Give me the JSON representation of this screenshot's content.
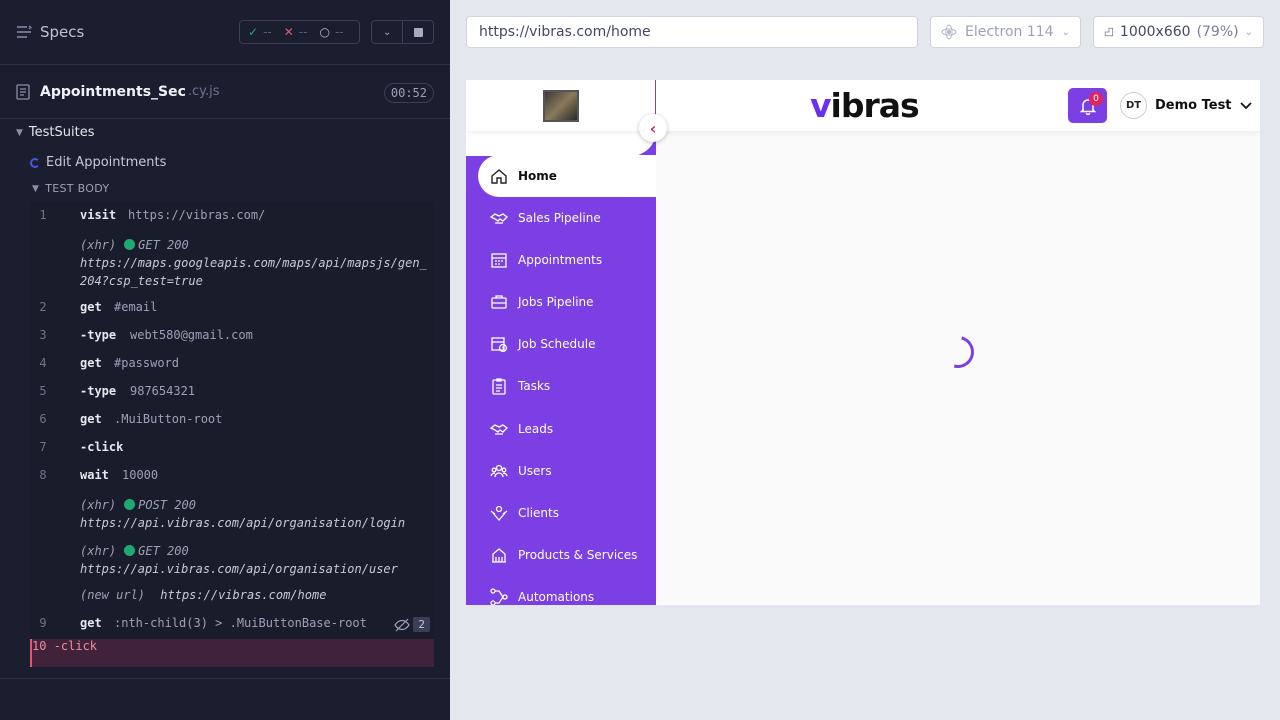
{
  "reporter": {
    "specs_label": "Specs",
    "stats": {
      "passed": "--",
      "failed": "--",
      "pending": "--"
    },
    "file": {
      "name": "Appointments_Sec",
      "ext": ".cy.js",
      "duration": "00:52"
    },
    "suite": "TestSuites",
    "test": "Edit Appointments",
    "body_label": "TEST BODY",
    "commands": [
      {
        "num": "1",
        "name": "visit",
        "message": "https://vibras.com/"
      },
      {
        "num": "2",
        "name": "get",
        "message": "#email"
      },
      {
        "num": "3",
        "name": "-type",
        "message": "webt580@gmail.com"
      },
      {
        "num": "4",
        "name": "get",
        "message": "#password"
      },
      {
        "num": "5",
        "name": "-type",
        "message": "987654321"
      },
      {
        "num": "6",
        "name": "get",
        "message": ".MuiButton-root"
      },
      {
        "num": "7",
        "name": "-click",
        "message": ""
      },
      {
        "num": "8",
        "name": "wait",
        "message": "10000"
      },
      {
        "num": "9",
        "name": "get",
        "message": ":nth-child(3) > .MuiButtonBase-root",
        "hidden_count": "2"
      },
      {
        "num": "10",
        "name": "-click",
        "message": ""
      }
    ],
    "logs": [
      {
        "tag": "(xhr)",
        "status": "GET 200",
        "url": "https://maps.googleapis.com/maps/api/mapsjs/gen_204?csp_test=true"
      },
      {
        "tag": "(xhr)",
        "status": "POST 200",
        "url": "https://api.vibras.com/api/organisation/login"
      },
      {
        "tag": "(xhr)",
        "status": "GET 200",
        "url": "https://api.vibras.com/api/organisation/user"
      },
      {
        "tag": "(new url)",
        "url": "https://vibras.com/home"
      }
    ]
  },
  "aut": {
    "url": "https://vibras.com/home",
    "browser": "Electron 114",
    "viewport": "1000x660",
    "scale": "(79%)"
  },
  "app": {
    "brand_v": "v",
    "brand_rest": "ibras",
    "notifications": "0",
    "user_initials": "DT",
    "user_name": "Demo Test",
    "nav": [
      {
        "label": "Home",
        "icon": "home-icon"
      },
      {
        "label": "Sales Pipeline",
        "icon": "handshake-icon"
      },
      {
        "label": "Appointments",
        "icon": "calendar-icon"
      },
      {
        "label": "Jobs Pipeline",
        "icon": "briefcase-icon"
      },
      {
        "label": "Job Schedule",
        "icon": "calendar-clock-icon"
      },
      {
        "label": "Tasks",
        "icon": "clipboard-icon"
      },
      {
        "label": "Leads",
        "icon": "handshake-icon"
      },
      {
        "label": "Users",
        "icon": "users-icon"
      },
      {
        "label": "Clients",
        "icon": "clients-icon"
      },
      {
        "label": "Products & Services",
        "icon": "building-icon"
      },
      {
        "label": "Automations",
        "icon": "flow-icon"
      }
    ]
  },
  "colors": {
    "accent": "#7b3fe4",
    "pass": "#1fa971",
    "fail": "#e45770",
    "reporter_bg": "#1b1e2e"
  }
}
